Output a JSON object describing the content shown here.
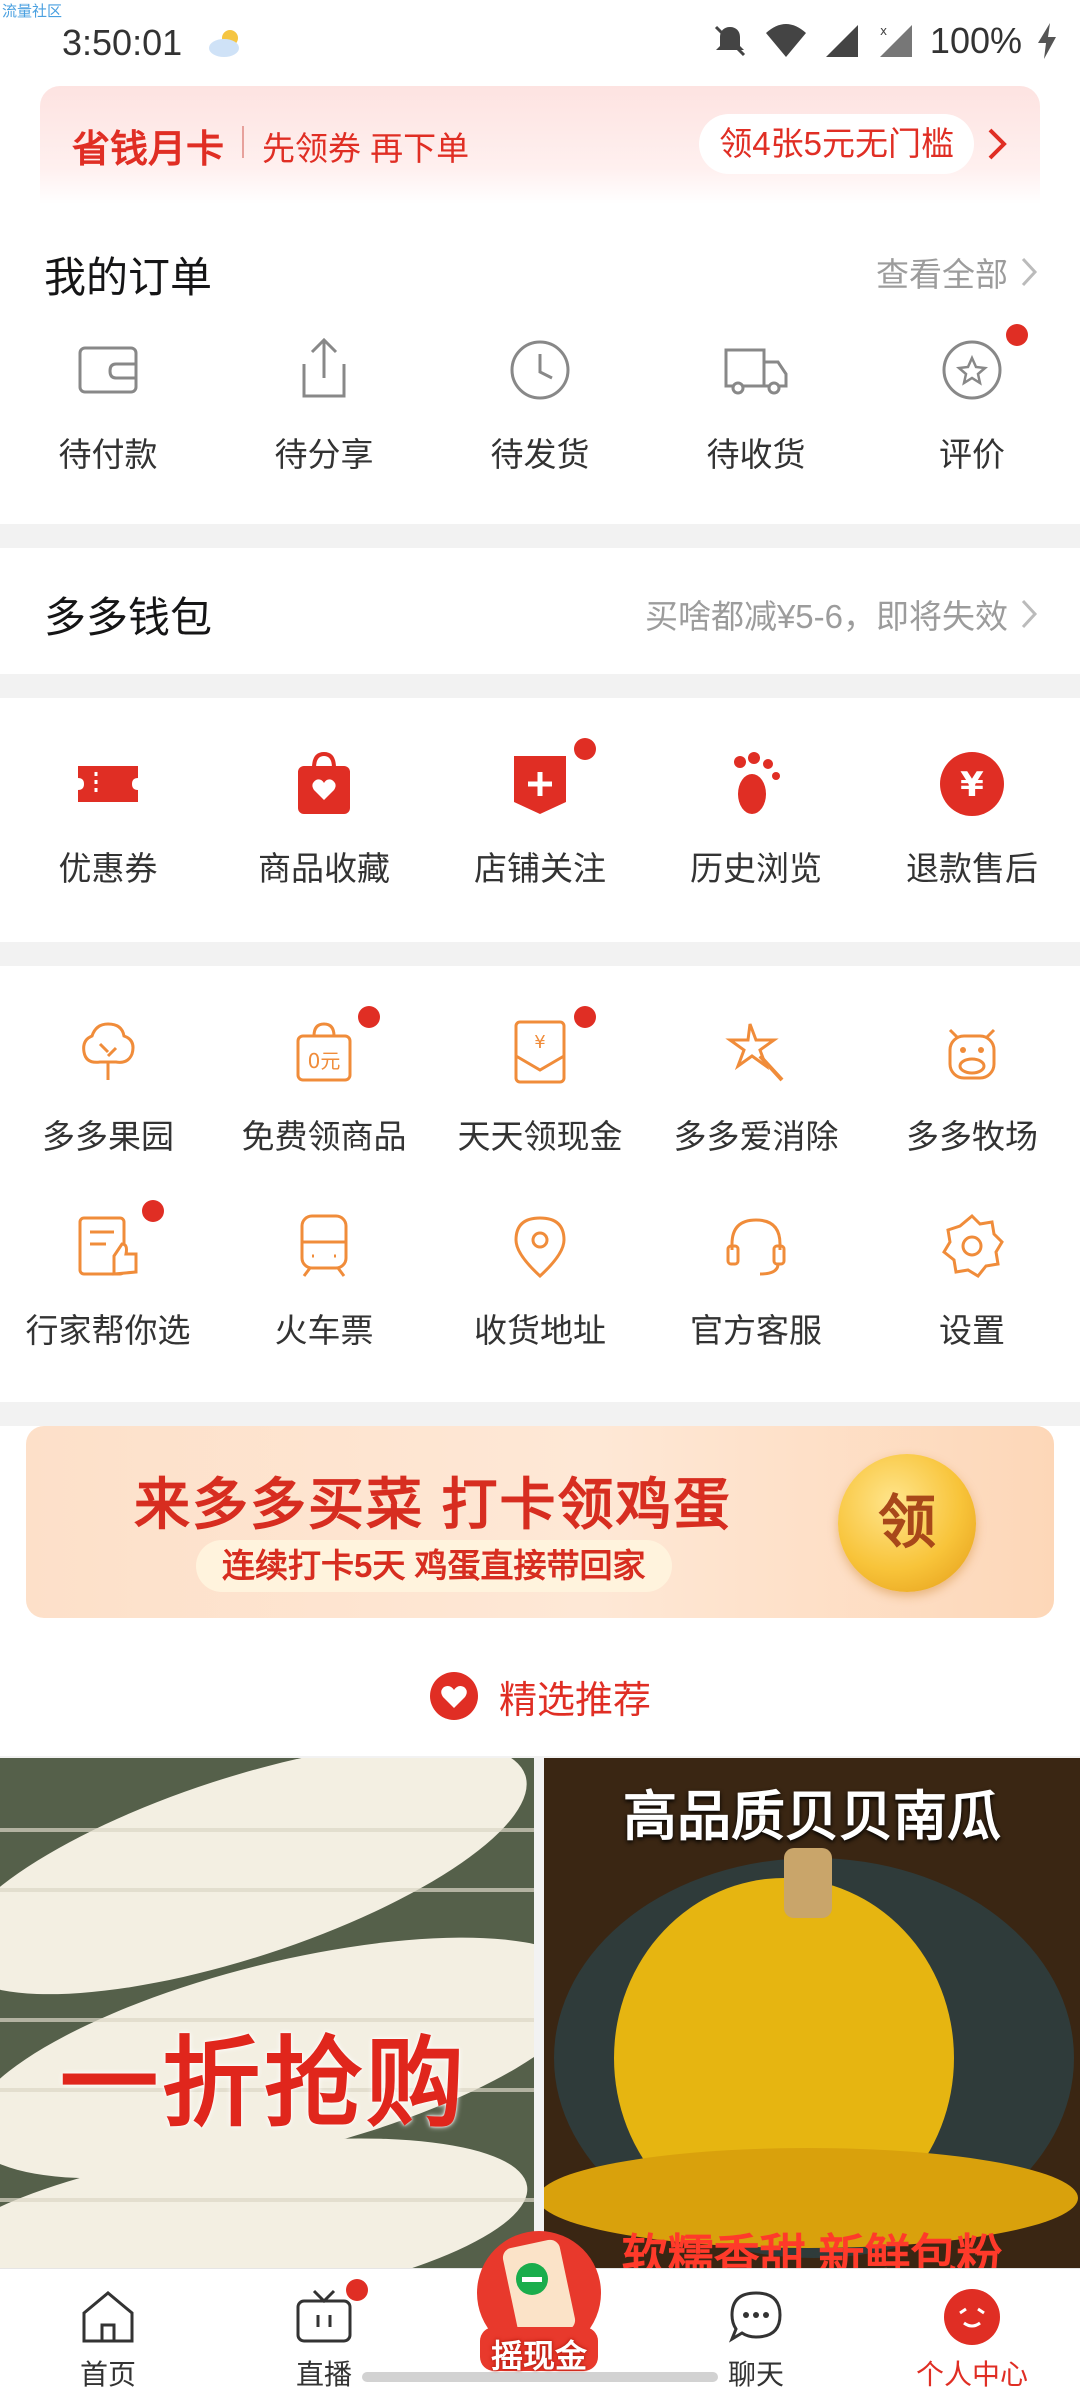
{
  "watermark": "流量社区",
  "status_bar": {
    "time": "3:50:01",
    "battery": "100%"
  },
  "promo": {
    "title": "省钱月卡",
    "subtitle": "先领券 再下单",
    "pill": "领4张5元无门槛"
  },
  "orders": {
    "title": "我的订单",
    "see_all": "查看全部",
    "items": [
      {
        "label": "待付款",
        "icon": "wallet-icon"
      },
      {
        "label": "待分享",
        "icon": "share-icon"
      },
      {
        "label": "待发货",
        "icon": "clock-icon"
      },
      {
        "label": "待收货",
        "icon": "truck-icon"
      },
      {
        "label": "评价",
        "icon": "review-star-icon",
        "badge": true
      }
    ]
  },
  "wallet": {
    "title": "多多钱包",
    "hint": "买啥都减¥5-6，即将失效"
  },
  "tools": {
    "items": [
      {
        "label": "优惠券",
        "icon": "coupon-icon"
      },
      {
        "label": "商品收藏",
        "icon": "favorite-bag-icon"
      },
      {
        "label": "店铺关注",
        "icon": "store-follow-icon",
        "badge": true
      },
      {
        "label": "历史浏览",
        "icon": "footprint-icon"
      },
      {
        "label": "退款售后",
        "icon": "refund-icon"
      }
    ]
  },
  "services": {
    "row1": [
      {
        "label": "多多果园",
        "icon": "tree-icon"
      },
      {
        "label": "免费领商品",
        "icon": "free-bag-icon",
        "badge": true
      },
      {
        "label": "天天领现金",
        "icon": "cash-envelope-icon",
        "badge": true
      },
      {
        "label": "多多爱消除",
        "icon": "star-wand-icon"
      },
      {
        "label": "多多牧场",
        "icon": "cow-icon"
      }
    ],
    "row2": [
      {
        "label": "行家帮你选",
        "icon": "thumb-list-icon",
        "badge": true
      },
      {
        "label": "火车票",
        "icon": "train-icon"
      },
      {
        "label": "收货地址",
        "icon": "location-icon"
      },
      {
        "label": "官方客服",
        "icon": "headset-icon"
      },
      {
        "label": "设置",
        "icon": "gear-icon"
      }
    ],
    "icon_color": "#f08c3a"
  },
  "egg_banner": {
    "title": "来多多买菜 打卡领鸡蛋",
    "subtitle": "连续打卡5天 鸡蛋直接带回家",
    "coin": "领"
  },
  "recommend": {
    "label": "精选推荐"
  },
  "products": [
    {
      "overlay": "一折抢购"
    },
    {
      "top": "高品质贝贝南瓜",
      "bottom": "软糯香甜 新鲜包粉"
    }
  ],
  "tabbar": {
    "items": [
      {
        "label": "首页",
        "icon": "home-icon"
      },
      {
        "label": "直播",
        "icon": "tv-icon",
        "badge": true
      },
      {
        "label": "摇现金",
        "icon": "shake-cash-icon"
      },
      {
        "label": "聊天",
        "icon": "chat-icon"
      },
      {
        "label": "个人中心",
        "icon": "profile-icon",
        "active": true
      }
    ]
  },
  "colors": {
    "brand": "#e02e24",
    "orange": "#f08c3a"
  }
}
